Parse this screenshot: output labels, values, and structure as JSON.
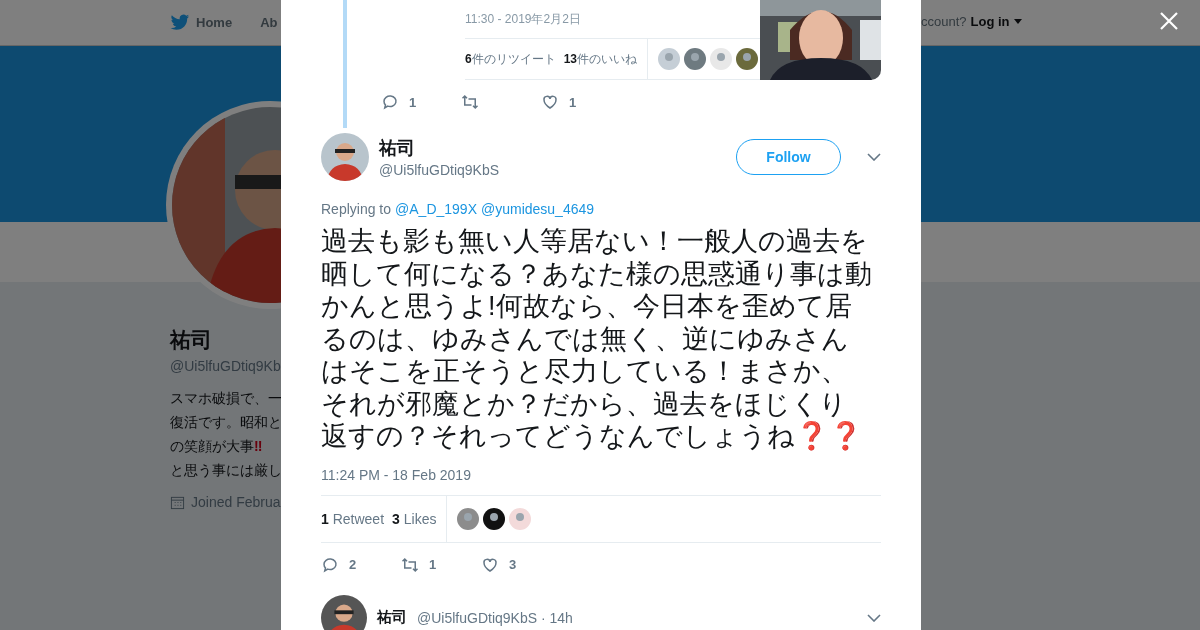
{
  "background": {
    "nav": [
      {
        "label": "Home",
        "kind": "home"
      },
      {
        "label": "Ab",
        "kind": "plain"
      }
    ],
    "account_prompt": "ccount?",
    "login": "Log in",
    "profile": {
      "name": "祐司",
      "handle": "@Ui5lfuGDtiq9Kb",
      "bio": [
        {
          "text": "スマホ破損で、一"
        },
        {
          "text": "復活です。昭和と"
        },
        {
          "text": "の笑顔が大事",
          "emoji": "‼"
        },
        {
          "text": "と思う事には厳し"
        }
      ],
      "joined": "Joined Februa"
    }
  },
  "previous_tweet": {
    "time": "11:30 - 2019年2月2日",
    "stats": [
      {
        "count": "6",
        "label": "件のリツイート"
      },
      {
        "count": "13",
        "label": "件のいいね"
      }
    ],
    "actions": [
      {
        "kind": "reply",
        "count": "1"
      },
      {
        "kind": "retweet"
      },
      {
        "kind": "like",
        "count": "1"
      }
    ]
  },
  "tweet": {
    "name": "祐司",
    "handle": "@Ui5lfuGDtiq9KbS",
    "follow": "Follow",
    "replying_prefix": "Replying to",
    "replying_to": [
      "@A_D_199X",
      "@yumidesu_4649"
    ],
    "text": "過去も影も無い人等居ない！一般人の過去を晒して何になる？あなた様の思惑通り事は動かんと思うよ!何故なら、今日本を歪めて居るのは、ゆみさんでは無く、逆にゆみさんはそこを正そうと尽力している！まさか、それが邪魔とか？だから、過去をほじくり返すの？それってどうなんでしょうね❓❓",
    "time": "11:24 PM - 18 Feb 2019",
    "stats": [
      {
        "count": "1",
        "label": "Retweet"
      },
      {
        "count": "3",
        "label": "Likes"
      }
    ],
    "actions": [
      {
        "kind": "reply",
        "count": "2"
      },
      {
        "kind": "retweet",
        "count": "1"
      },
      {
        "kind": "like",
        "count": "3"
      }
    ]
  },
  "next_tweet": {
    "name": "祐司",
    "handle": "@Ui5lfuGDtiq9KbS · 14h"
  }
}
